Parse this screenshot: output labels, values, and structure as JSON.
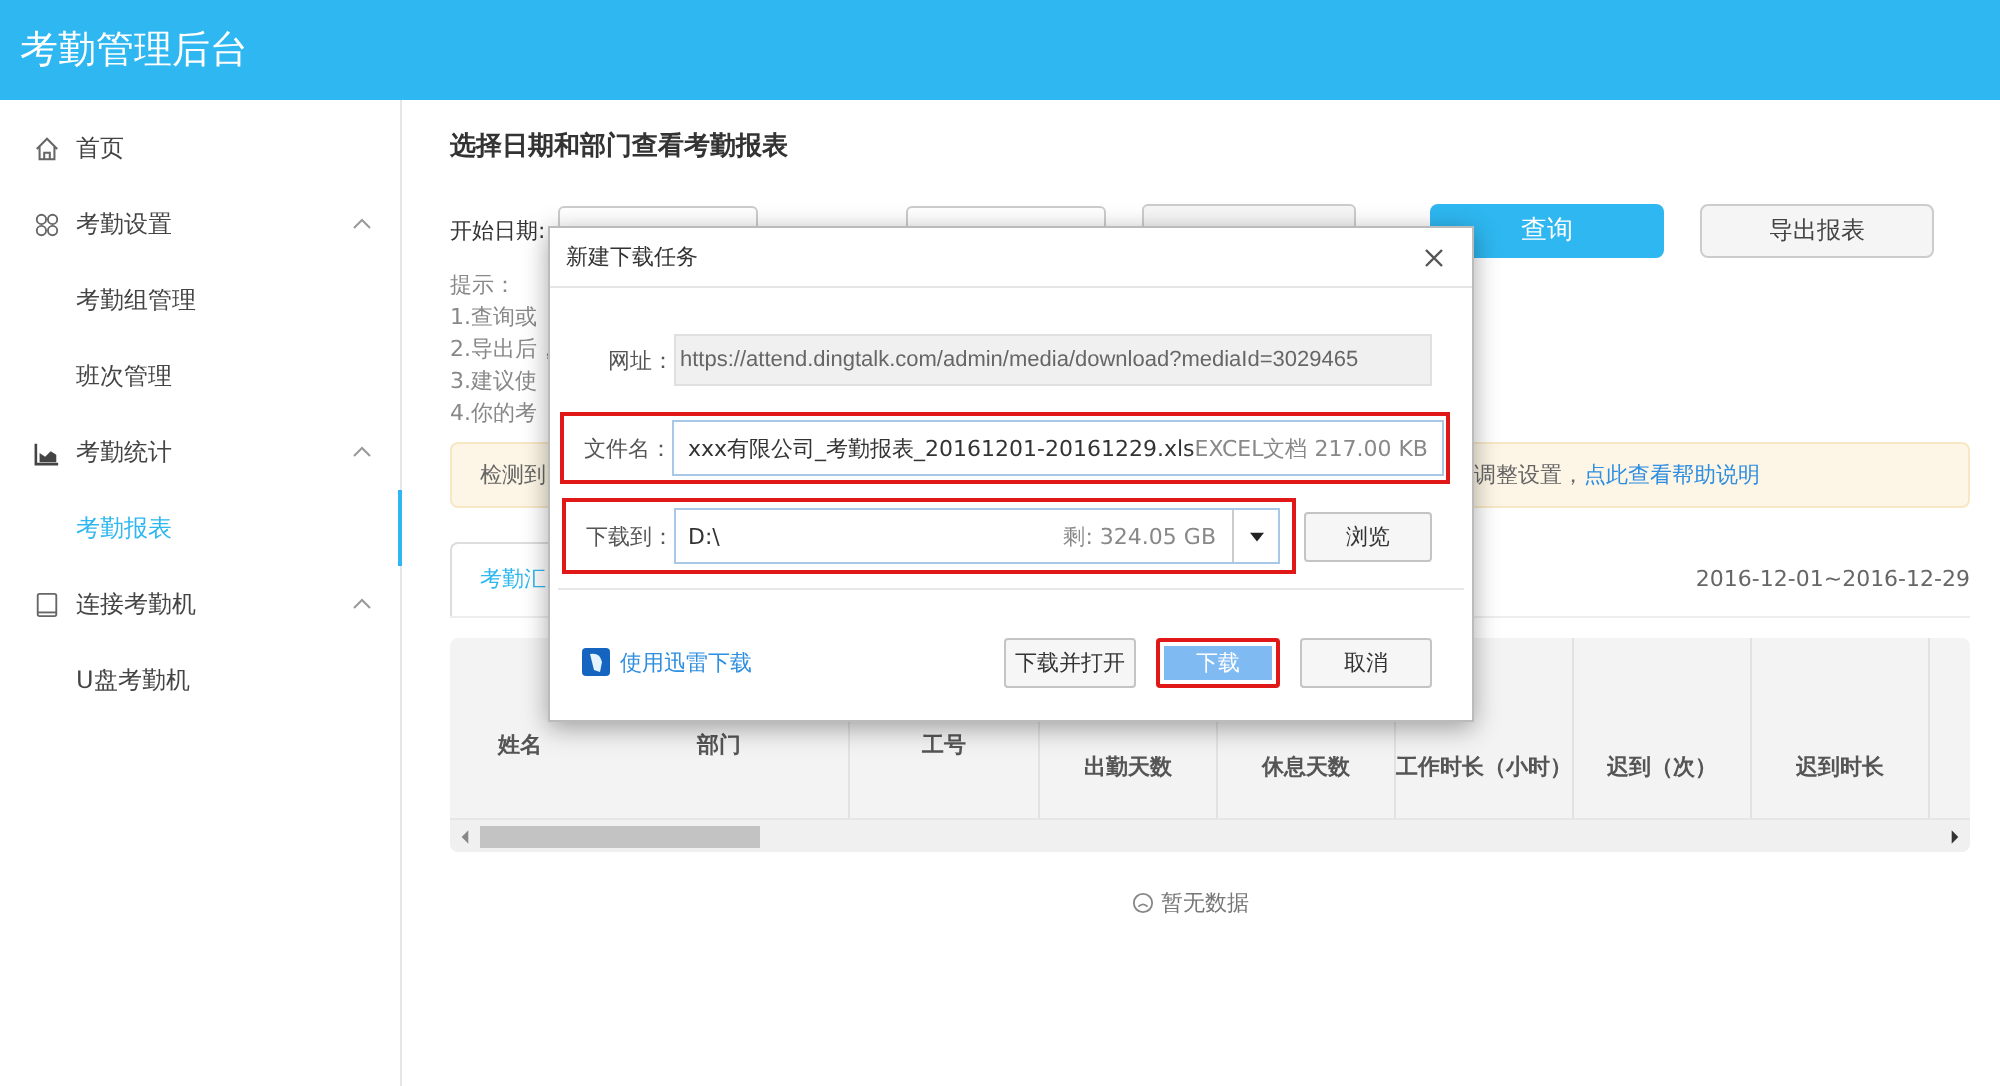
{
  "header": {
    "title": "考勤管理后台"
  },
  "sidebar": {
    "items": [
      {
        "label": "首页",
        "kind": "home",
        "selected": false
      },
      {
        "label": "考勤设置",
        "kind": "group",
        "selected": false,
        "expanded": true,
        "children": [
          {
            "label": "考勤组管理",
            "selected": false
          },
          {
            "label": "班次管理",
            "selected": false
          }
        ]
      },
      {
        "label": "考勤统计",
        "kind": "chart",
        "selected": false,
        "expanded": true,
        "children": [
          {
            "label": "考勤报表",
            "selected": true
          }
        ]
      },
      {
        "label": "连接考勤机",
        "kind": "device",
        "selected": false,
        "expanded": true,
        "children": [
          {
            "label": "U盘考勤机",
            "selected": false
          }
        ]
      }
    ]
  },
  "main": {
    "title": "选择日期和部门查看考勤报表",
    "start_label": "开始日期:",
    "query_button": "查询",
    "export_button": "导出报表",
    "tips": [
      "提示：",
      "1.查询或",
      "2.导出后，",
      "3.建议使",
      "4.你的考"
    ],
    "notice": {
      "text_start": "检测到",
      "text_end": "调整设置，",
      "link": "点此查看帮助说明"
    },
    "tabs": [
      {
        "label": "考勤汇",
        "selected": true
      }
    ],
    "date_range": "2016-12-01~2016-12-29",
    "table": {
      "columns": [
        {
          "label": "姓名",
          "kind": "tall"
        },
        {
          "label": "部门",
          "kind": "tall"
        },
        {
          "label": "工号",
          "kind": "tall"
        },
        {
          "label": "出勤天数",
          "kind": "sub"
        },
        {
          "label": "休息天数",
          "kind": "sub"
        },
        {
          "label": "工作时长（小时）",
          "kind": "sub"
        },
        {
          "label": "迟到（次）",
          "kind": "sub"
        },
        {
          "label": "迟到时长",
          "kind": "sub"
        }
      ]
    },
    "empty_text": "暂无数据"
  },
  "dialog": {
    "title": "新建下载任务",
    "url": {
      "label": "网址：",
      "value": "https://attend.dingtalk.com/admin/media/download?mediaId=3029465"
    },
    "filename": {
      "label": "文件名：",
      "value": "xxx有限公司_考勤报表_20161201-20161229.xls",
      "info": "EXCEL文档 217.00 KB",
      "highlighted": true
    },
    "target": {
      "label": "下载到：",
      "value": "D:\\",
      "free": "剩: 324.05 GB",
      "highlighted": true
    },
    "browse_button": "浏览",
    "xunlei_link": "使用迅雷下载",
    "buttons": [
      {
        "label": "下载并打开",
        "kind": "normal",
        "highlighted": false
      },
      {
        "label": "下载",
        "kind": "primary",
        "highlighted": true
      },
      {
        "label": "取消",
        "kind": "normal",
        "highlighted": false
      }
    ]
  }
}
